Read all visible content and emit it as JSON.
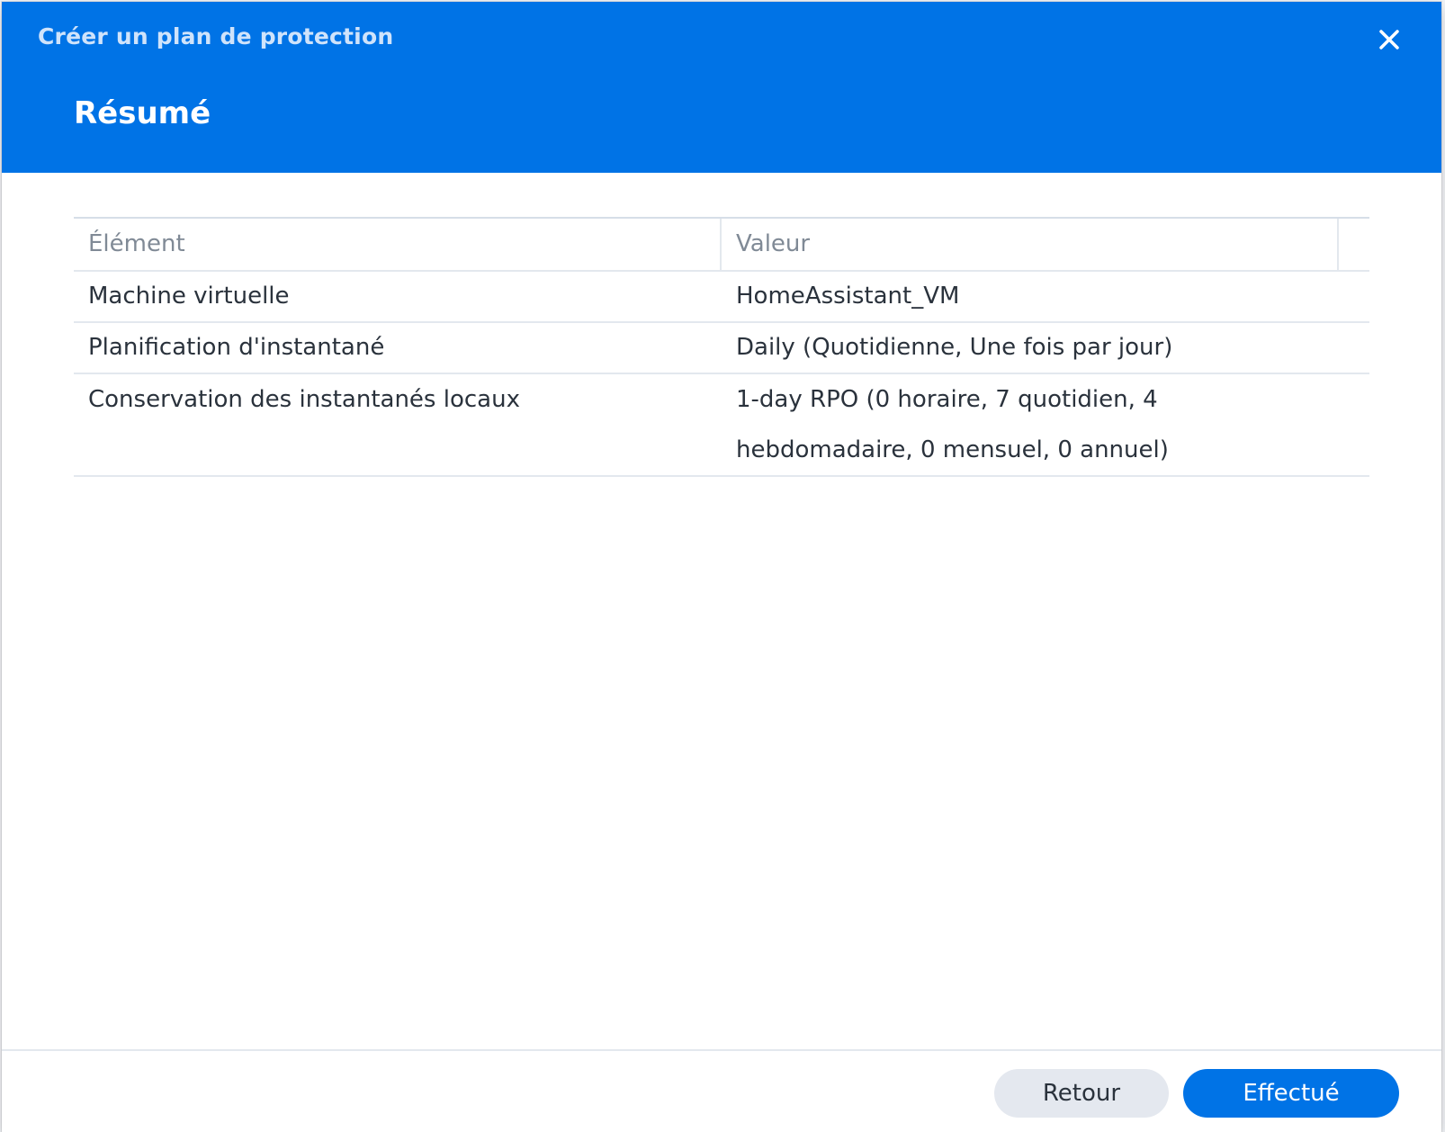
{
  "window": {
    "title": "Créer un plan de protection",
    "close_icon": "close-icon"
  },
  "step": {
    "title": "Résumé"
  },
  "table": {
    "columns": [
      "Élément",
      "Valeur"
    ],
    "rows": [
      {
        "item": "Machine virtuelle",
        "value_lines": [
          "HomeAssistant_VM"
        ]
      },
      {
        "item": "Planification d'instantané",
        "value_lines": [
          "Daily (Quotidienne, Une fois par jour)"
        ]
      },
      {
        "item": "Conservation des instantanés locaux",
        "value_lines": [
          "1-day RPO (0 horaire, 7 quotidien, 4",
          "hebdomadaire, 0 mensuel, 0 annuel)"
        ]
      }
    ]
  },
  "footer": {
    "back_label": "Retour",
    "done_label": "Effectué"
  },
  "colors": {
    "accent": "#0073e6",
    "header_title": "#cfe3fb",
    "secondary_button": "#e4e8ef"
  }
}
